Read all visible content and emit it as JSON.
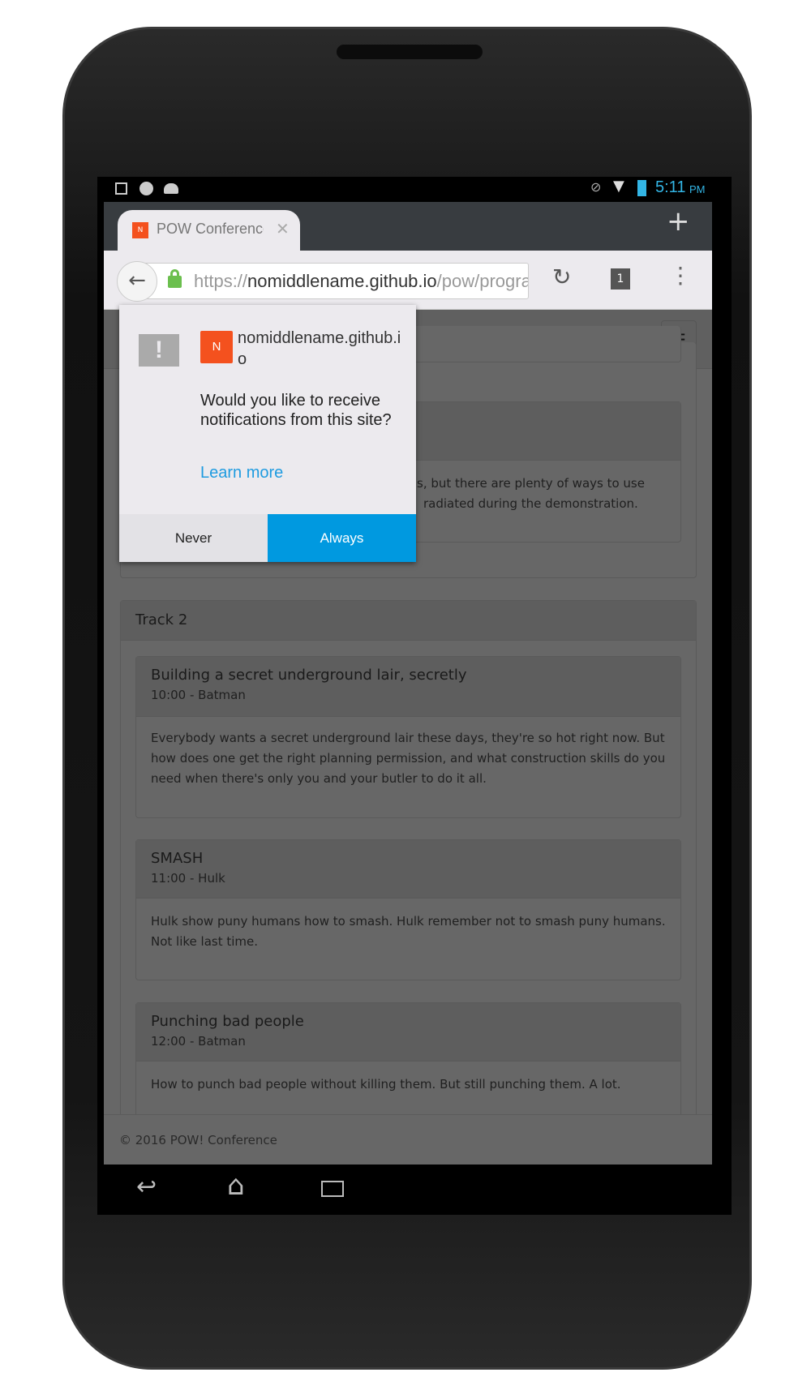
{
  "status_bar": {
    "time": "5:11",
    "ampm": "PM",
    "icons": [
      "image-icon",
      "sync-icon",
      "android-icon",
      "mute-icon",
      "wifi-icon",
      "battery-charging-icon"
    ]
  },
  "browser": {
    "tab_title": "POW Conference",
    "tab_favicon": "N",
    "url_scheme": "https://",
    "url_host": "nomiddlename.github.io",
    "url_path": "/pow/program",
    "tab_count": "1"
  },
  "page": {
    "track1_fragments": [
      "s, but there are plenty of ways to use",
      "radiated during the demonstration."
    ],
    "track2": {
      "title": "Track 2",
      "sessions": [
        {
          "title": "Building a secret underground lair, secretly",
          "meta": "10:00 - Batman",
          "body": "Everybody wants a secret underground lair these days, they're so hot right now. But how does one get the right planning permission, and what construction skills do you need when there's only you and your butler to do it all."
        },
        {
          "title": "SMASH",
          "meta": "11:00 - Hulk",
          "body": "Hulk show puny humans how to smash. Hulk remember not to smash puny humans. Not like last time."
        },
        {
          "title": "Punching bad people",
          "meta": "12:00 - Batman",
          "body": "How to punch bad people without killing them. But still punching them. A lot."
        }
      ]
    },
    "footer": "© 2016 POW! Conference"
  },
  "popup": {
    "site": "nomiddlename.github.io",
    "site_icon": "N",
    "question": "Would you like to receive notifications from this site?",
    "learn_more": "Learn more",
    "never": "Never",
    "always": "Always"
  },
  "colors": {
    "accent": "#0099e0",
    "favicon": "#f4511e",
    "link": "#1e9be0",
    "lock": "#6bbf4e"
  }
}
